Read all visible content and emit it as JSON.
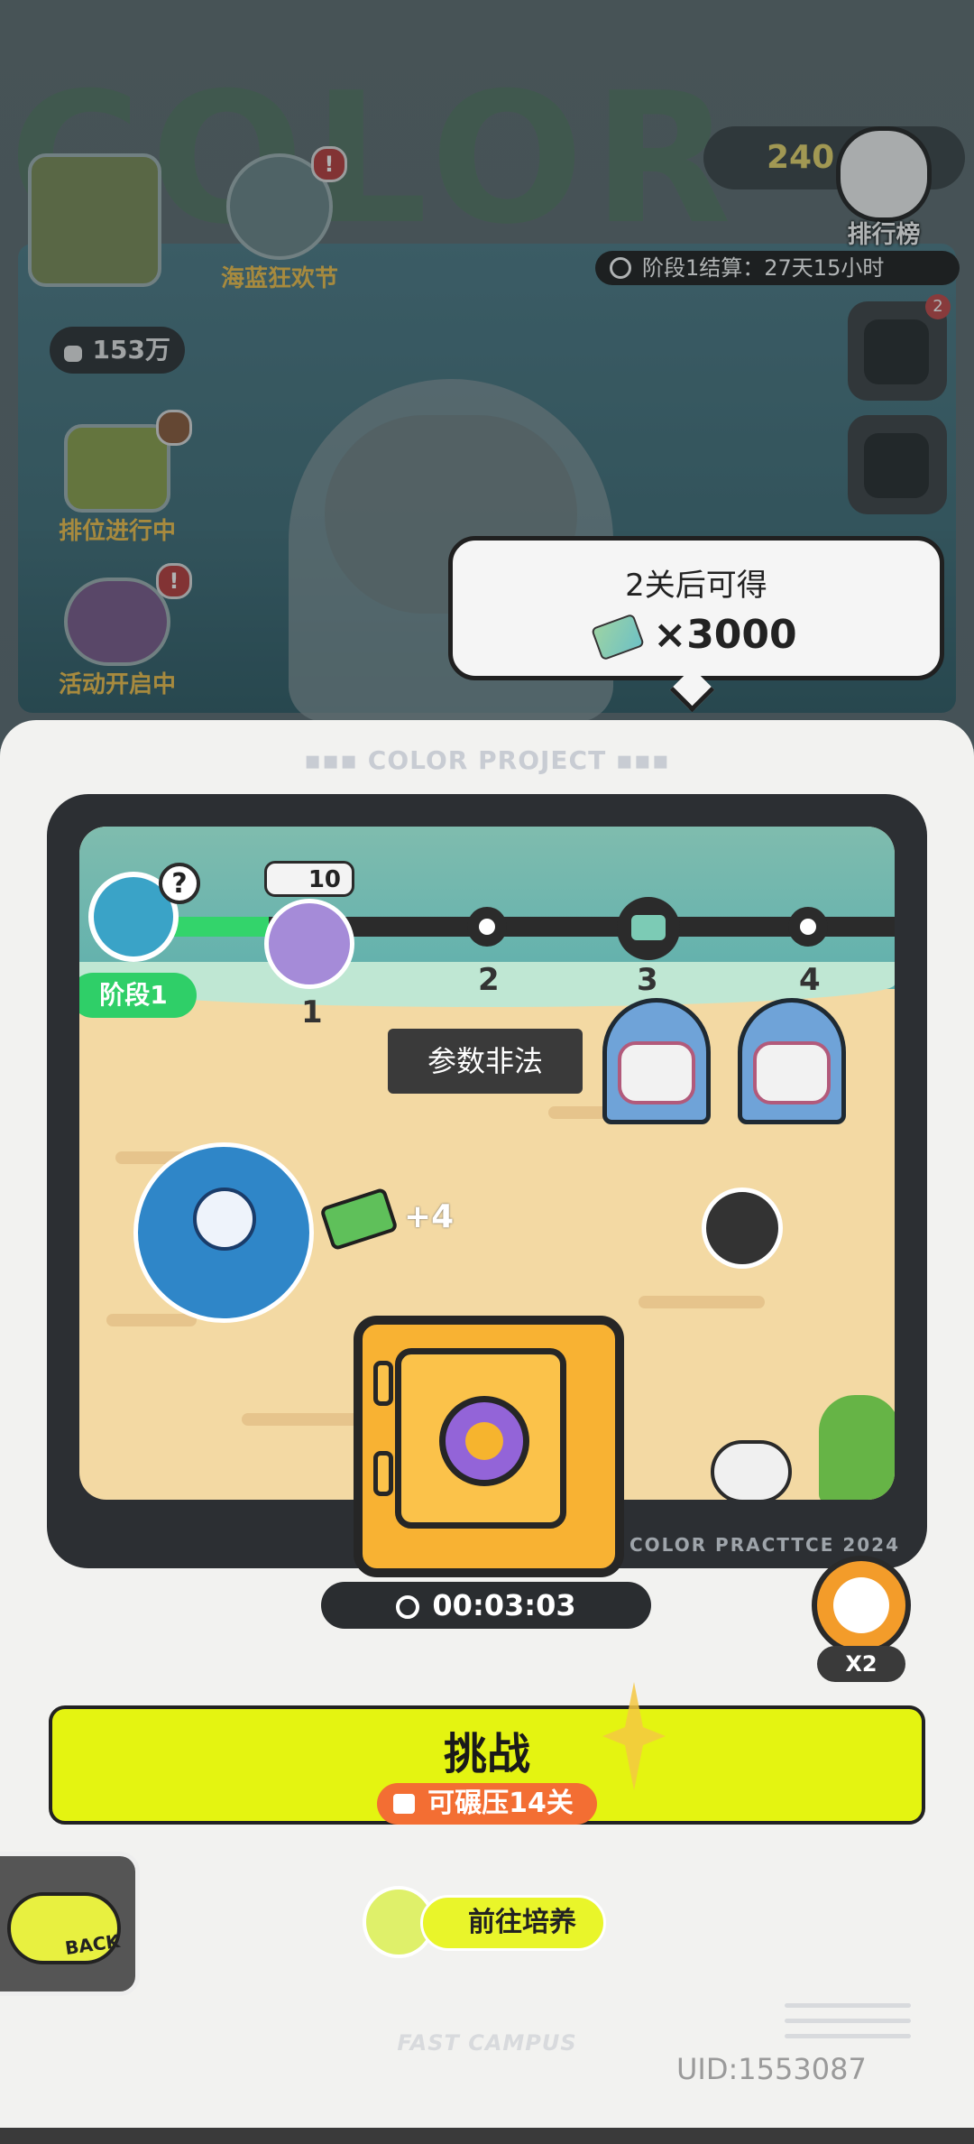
{
  "background": {
    "big_text": "COLOR",
    "left_icons": [
      {
        "label": "海蓝狂欢节",
        "badge": "!"
      },
      {
        "label": "排位进行中",
        "badge": "!"
      },
      {
        "label": "活动开启中",
        "badge": "!"
      }
    ],
    "power": "153万",
    "coins": "240",
    "rank_label": "排行榜",
    "stage_settle": "阶段1结算：27天15小时",
    "side_badge": "2"
  },
  "tooltip": {
    "title": "2关后可得",
    "reward": "×3000"
  },
  "panel": {
    "header": "▪▪▪ COLOR PROJECT ▪▪▪",
    "frame_label": "COLOR PRACTTCE 2024",
    "player_count": "10",
    "stage_chip": "阶段1",
    "nodes": [
      "1",
      "2",
      "3",
      "4"
    ],
    "error_text": "参数非法",
    "money_gain": "+4",
    "timer": "00:03:03",
    "alarm_multiplier": "X2",
    "help": "?"
  },
  "challenge": {
    "title": "挑战",
    "sweep": "可碾压14关"
  },
  "back": {
    "label": "BACK"
  },
  "train": {
    "label": "前往培养"
  },
  "footer": {
    "fast_campus": "FAST CAMPUS",
    "uid": "UID:1553087"
  },
  "colors": {
    "accent_yellow": "#e4f411",
    "stage_green": "#2fcf68",
    "sweep_orange": "#f36e33",
    "safe_orange": "#f8b233"
  }
}
